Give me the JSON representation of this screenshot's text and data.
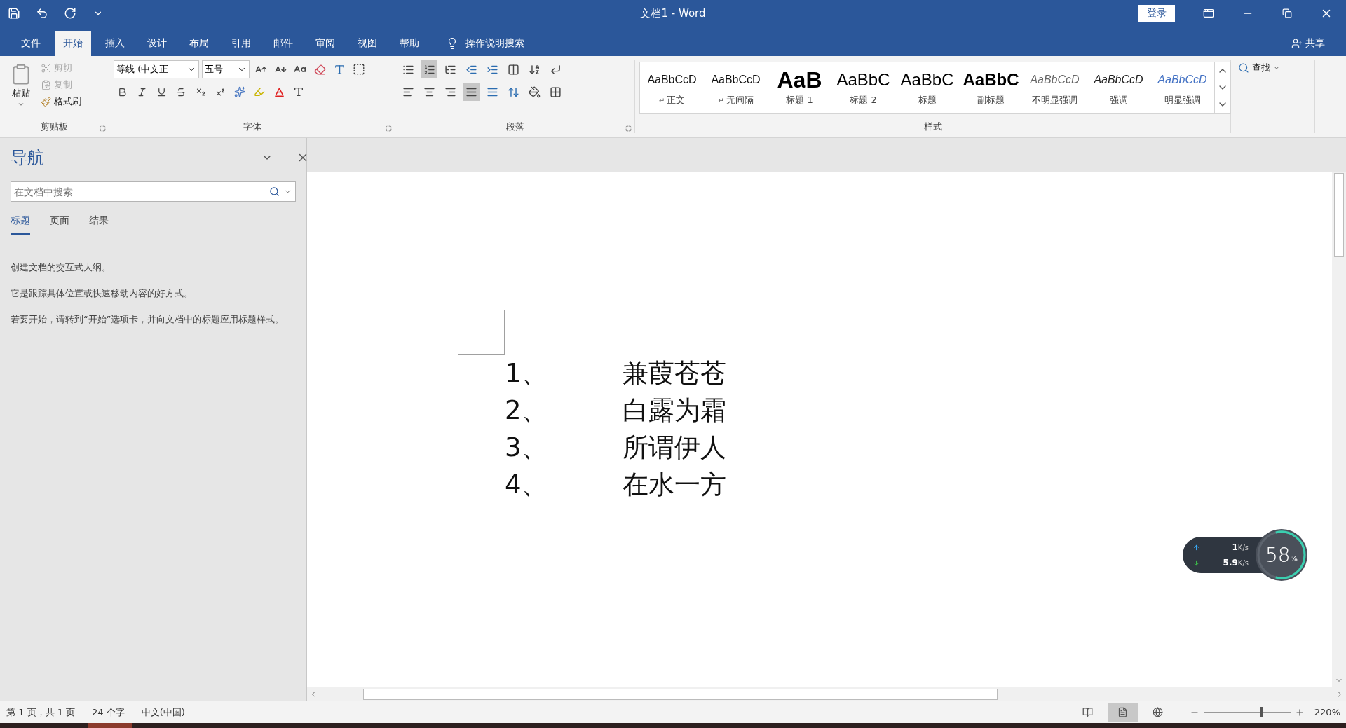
{
  "window": {
    "title": "文档1  -  Word",
    "sign_in": "登录"
  },
  "menu_tabs": [
    {
      "label": "文件",
      "selected": false
    },
    {
      "label": "开始",
      "selected": true
    },
    {
      "label": "插入",
      "selected": false
    },
    {
      "label": "设计",
      "selected": false
    },
    {
      "label": "布局",
      "selected": false
    },
    {
      "label": "引用",
      "selected": false
    },
    {
      "label": "邮件",
      "selected": false
    },
    {
      "label": "审阅",
      "selected": false
    },
    {
      "label": "视图",
      "selected": false
    },
    {
      "label": "帮助",
      "selected": false
    }
  ],
  "tell_me": "操作说明搜索",
  "share": "共享",
  "ribbon": {
    "clipboard": {
      "title": "剪贴板",
      "paste": "粘贴",
      "cut": {
        "label": "剪切",
        "disabled": true
      },
      "copy": {
        "label": "复制",
        "disabled": true
      },
      "format_painter": {
        "label": "格式刷",
        "disabled": false
      }
    },
    "font": {
      "title": "字体",
      "font_name": "等线 (中文正",
      "font_size": "五号"
    },
    "paragraph": {
      "title": "段落",
      "numbering_on": true,
      "justify_on": true
    },
    "styles": {
      "title": "样式",
      "items": [
        {
          "kind": "normal",
          "preview": "AaBbCcD",
          "mark": "↵",
          "label": "正文"
        },
        {
          "kind": "normal",
          "preview": "AaBbCcD",
          "mark": "↵",
          "label": "无间隔"
        },
        {
          "kind": "heading1",
          "preview": "AaB",
          "label": "标题 1"
        },
        {
          "kind": "heading2",
          "preview": "AaBbC",
          "label": "标题 2"
        },
        {
          "kind": "title",
          "preview": "AaBbC",
          "label": "标题"
        },
        {
          "kind": "subtitle",
          "preview": "AaBbC",
          "label": "副标题"
        },
        {
          "kind": "subtle",
          "preview": "AaBbCcD",
          "label": "不明显强调"
        },
        {
          "kind": "emphasis",
          "preview": "AaBbCcD",
          "label": "强调"
        },
        {
          "kind": "intense",
          "preview": "AaBbCcD",
          "label": "明显强调"
        }
      ]
    },
    "editing": {
      "find": "查找"
    }
  },
  "navigation": {
    "title": "导航",
    "search": {
      "placeholder": "在文档中搜索"
    },
    "tabs": [
      {
        "label": "标题",
        "selected": true
      },
      {
        "label": "页面",
        "selected": false
      },
      {
        "label": "结果",
        "selected": false
      }
    ],
    "paragraphs": [
      "创建文档的交互式大纲。",
      "它是跟踪具体位置或快速移动内容的好方式。",
      "若要开始，请转到“开始”选项卡，并向文档中的标题应用标题样式。"
    ]
  },
  "document": {
    "list": [
      {
        "number": "1、",
        "text": "兼葭苍苍"
      },
      {
        "number": "2、",
        "text": "白露为霜"
      },
      {
        "number": "3、",
        "text": "所谓伊人"
      },
      {
        "number": "4、",
        "text": "在水一方"
      }
    ]
  },
  "network_widget": {
    "upload": "1",
    "upload_unit": "K/s",
    "download": "5.9",
    "download_unit": "K/s",
    "percent": "58",
    "percent_sign": "%",
    "level": 0.58
  },
  "status_bar": {
    "page": "第 1 页，共 1 页",
    "words": "24 个字",
    "language": "中文(中国)",
    "views": [
      {
        "kind": "read",
        "selected": false
      },
      {
        "kind": "print",
        "selected": true
      },
      {
        "kind": "web",
        "selected": false
      }
    ],
    "zoom": {
      "level": 0.65,
      "reading": "220%"
    }
  }
}
